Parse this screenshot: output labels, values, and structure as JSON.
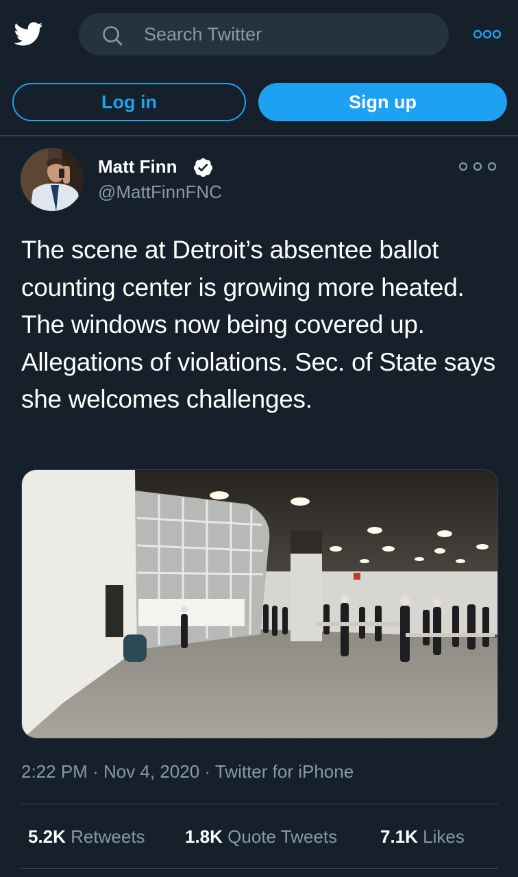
{
  "header": {
    "logo_icon": "twitter-bird-icon",
    "search": {
      "icon": "search-icon",
      "placeholder": "Search Twitter"
    },
    "more_icon": "more-options-icon"
  },
  "auth": {
    "login_label": "Log in",
    "signup_label": "Sign up"
  },
  "tweet": {
    "author": {
      "name": "Matt Finn",
      "handle": "@MattFinnFNC",
      "verified": true,
      "avatar_icon": "avatar"
    },
    "text": "The scene at Detroit’s absentee ballot counting center is growing more heated.  The windows now being covered up. Allegations of violations. Sec. of State says she welcomes challenges.",
    "media": {
      "type": "video-thumbnail"
    },
    "meta": {
      "time": "2:22 PM",
      "date": "Nov 4, 2020",
      "source": "Twitter for iPhone",
      "separator": "·"
    },
    "stats": [
      {
        "count": "5.2K",
        "label": "Retweets"
      },
      {
        "count": "1.8K",
        "label": "Quote Tweets"
      },
      {
        "count": "7.1K",
        "label": "Likes"
      }
    ]
  },
  "colors": {
    "background": "#15202b",
    "accent": "#1da1f2",
    "secondary_text": "#8899a6",
    "divider": "#38444d",
    "search_bg": "#253341"
  }
}
